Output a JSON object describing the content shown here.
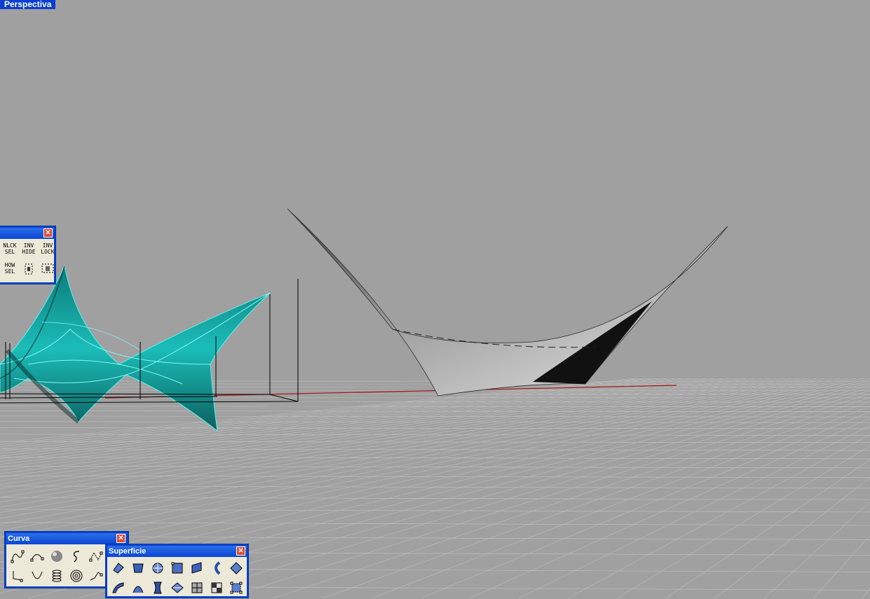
{
  "viewport": {
    "label": "Perspectiva",
    "background": "#a0a0a0",
    "grid_color": "#bdbdbd",
    "axis_color": "#a31515",
    "selected_color": "#0fa3a3"
  },
  "toolbars": {
    "select": {
      "title": "",
      "close": "✕",
      "buttons": [
        {
          "label": "NLCK\nSEL"
        },
        {
          "label": "INV\nHIDE"
        },
        {
          "label": "INV\nLOCK"
        },
        {
          "label": "HOW\nSEL"
        },
        {
          "label": "",
          "icon": "hide-points-icon"
        },
        {
          "label": "",
          "icon": "lock-points-icon"
        }
      ]
    },
    "curva": {
      "title": "Curva",
      "close": "✕",
      "buttons": [
        {
          "icon": "control-point-curve-icon"
        },
        {
          "icon": "interpolate-curve-icon"
        },
        {
          "icon": "sphere-icon"
        },
        {
          "icon": "freeform-curve-icon"
        },
        {
          "icon": "polyline-points-icon"
        },
        {
          "icon": "line-endpoints-icon"
        },
        {
          "icon": "arc-curve-icon"
        },
        {
          "icon": "helix-icon"
        },
        {
          "icon": "spiral-icon"
        },
        {
          "icon": "polyline-icon"
        }
      ]
    },
    "superficie": {
      "title": "Superficie",
      "close": "✕",
      "buttons": [
        {
          "icon": "surface-from-points-icon"
        },
        {
          "icon": "edge-surface-icon"
        },
        {
          "icon": "planar-curves-icon"
        },
        {
          "icon": "surface-corner-icon"
        },
        {
          "icon": "extrude-surface-icon"
        },
        {
          "icon": "loft-icon"
        },
        {
          "icon": "sweep-icon"
        },
        {
          "icon": "revolve-icon"
        },
        {
          "icon": "rail-revolve-icon"
        },
        {
          "icon": "pipe-icon"
        },
        {
          "icon": "patch-icon"
        },
        {
          "icon": "network-surface-icon"
        },
        {
          "icon": "split-surface-icon"
        },
        {
          "icon": "control-points-icon"
        }
      ]
    }
  }
}
